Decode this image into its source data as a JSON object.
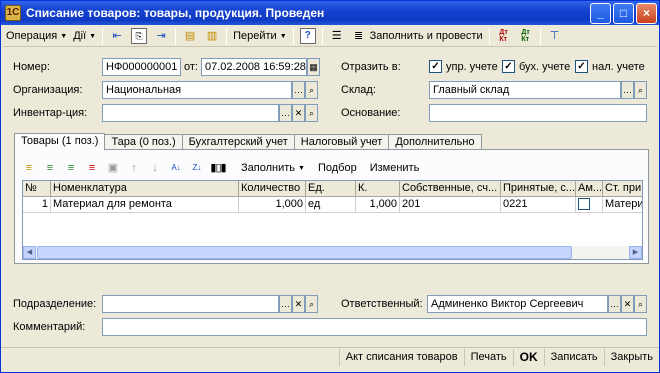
{
  "window": {
    "app_icon": "1С",
    "title": "Списание товаров: товары, продукция. Проведен",
    "controls": [
      "_",
      "□",
      "×"
    ]
  },
  "toolbar": {
    "operation": "Операция",
    "actions": "Дії",
    "goto": "Перейти",
    "help": "?",
    "fill_and_post": "Заполнить и провести",
    "dt_kt_1": "Дт\nКт",
    "dt_kt_2": "Дт\nКт"
  },
  "form": {
    "number_label": "Номер:",
    "number_value": "НФ000000001",
    "date_label": "от:",
    "date_value": "07.02.2008 16:59:28",
    "reflect_label": "Отразить в:",
    "reflect_options": [
      {
        "label": "упр. учете",
        "checked": true
      },
      {
        "label": "бух. учете",
        "checked": true
      },
      {
        "label": "нал. учете",
        "checked": true
      }
    ],
    "org_label": "Организация:",
    "org_value": "Национальная",
    "warehouse_label": "Склад:",
    "warehouse_value": "Главный склад",
    "inventory_label": "Инвентар-ция:",
    "inventory_value": "",
    "basis_label": "Основание:",
    "basis_value": ""
  },
  "tabs": [
    {
      "label": "Товары (1 поз.)",
      "active": true
    },
    {
      "label": "Тара (0 поз.)",
      "active": false
    },
    {
      "label": "Бухгалтерский учет",
      "active": false
    },
    {
      "label": "Налоговый учет",
      "active": false
    },
    {
      "label": "Дополнительно",
      "active": false
    }
  ],
  "table_toolbar": {
    "fill": "Заполнить",
    "select": "Подбор",
    "change": "Изменить"
  },
  "table": {
    "columns": [
      "№",
      "Номенклатура",
      "Количество",
      "Ед.",
      "К.",
      "Собственные, сч...",
      "Принятые, с...",
      "Ам...",
      "Ст. при"
    ],
    "rows": [
      [
        "1",
        "Материал для ремонта",
        "1,000",
        "ед",
        "1,000",
        "201",
        "0221",
        "",
        "Матери"
      ]
    ]
  },
  "footer_form": {
    "department_label": "Подразделение:",
    "department_value": "",
    "responsible_label": "Ответственный:",
    "responsible_value": "Админенко Виктор Сергеевич",
    "comment_label": "Комментарий:",
    "comment_value": ""
  },
  "bottom_buttons": {
    "act": "Акт списания товаров",
    "print": "Печать",
    "ok": "OK",
    "save": "Записать",
    "close": "Закрыть"
  }
}
